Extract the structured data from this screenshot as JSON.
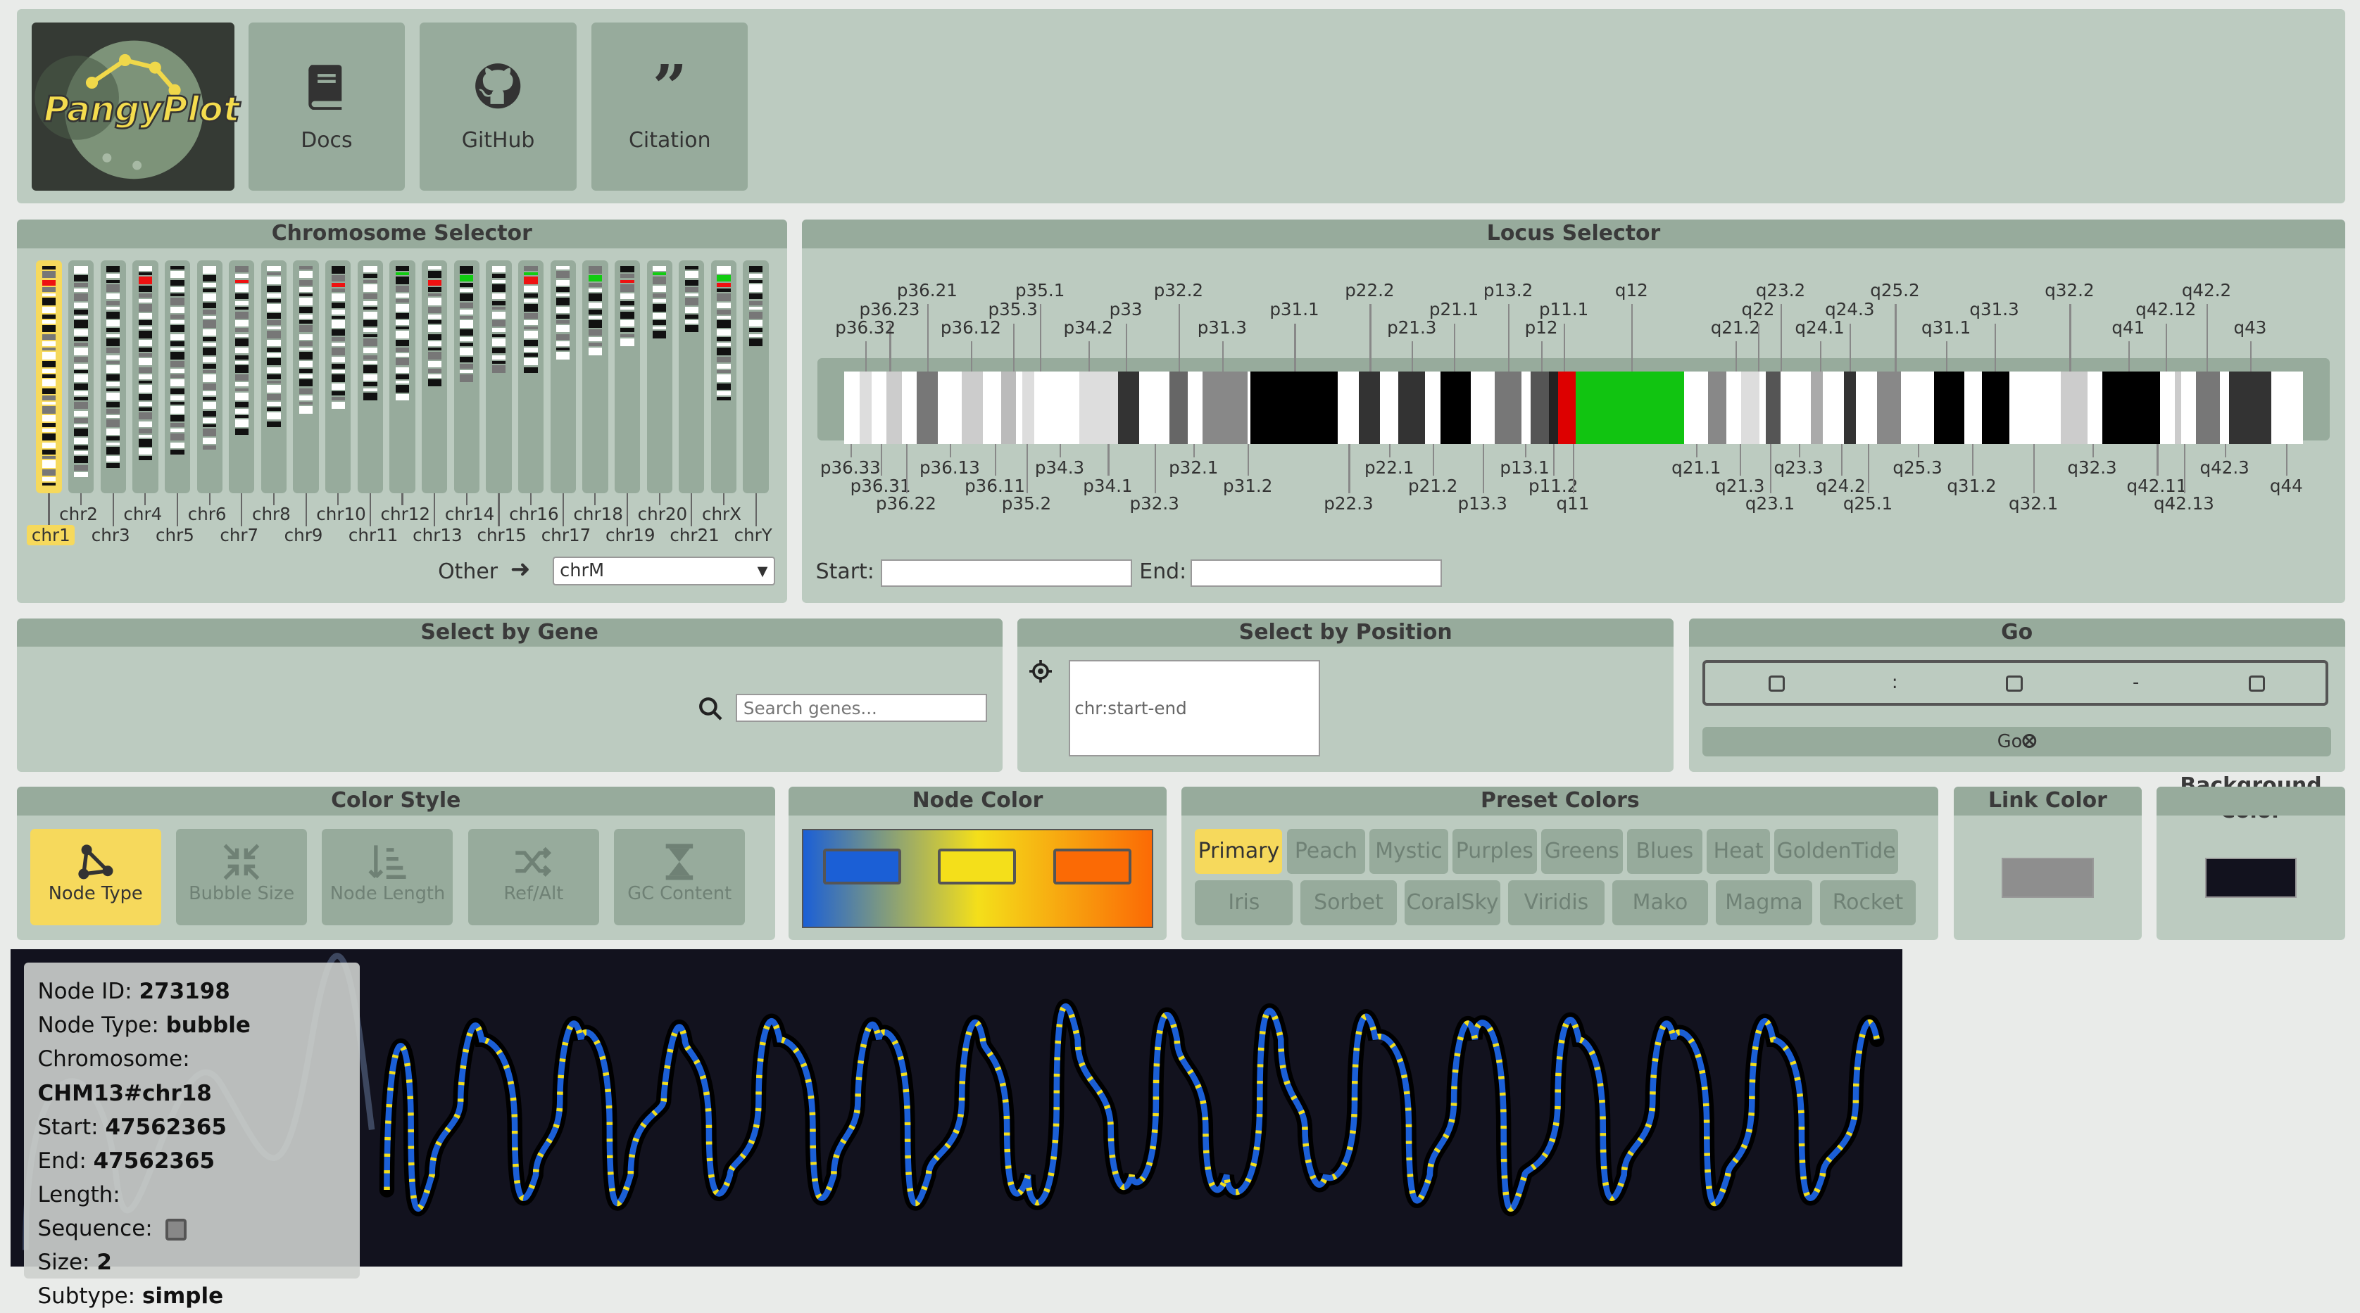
{
  "header": {
    "logo_text": "PangyPlot",
    "nav": [
      {
        "label": "Docs",
        "icon": "book-icon"
      },
      {
        "label": "GitHub",
        "icon": "github-icon"
      },
      {
        "label": "Citation",
        "icon": "quote-icon"
      }
    ]
  },
  "chromosome_selector": {
    "title": "Chromosome Selector",
    "selected": "chr1",
    "top_labels": [
      "chr2",
      "chr4",
      "chr6",
      "chr8",
      "chr10",
      "chr12",
      "chr14",
      "chr16",
      "chr18",
      "chr20",
      "chrX"
    ],
    "bottom_labels": [
      "chr1",
      "chr3",
      "chr5",
      "chr7",
      "chr9",
      "chr11",
      "chr13",
      "chr15",
      "chr17",
      "chr19",
      "chr21",
      "chrY"
    ],
    "other_label": "Other",
    "other_value": "chrM"
  },
  "locus_selector": {
    "title": "Locus Selector",
    "bands_top": [
      "p36.21",
      "p36.23",
      "p36.32",
      "p35.1",
      "p35.3",
      "p36.12",
      "p34.2",
      "p33",
      "p32.2",
      "p31.3",
      "p31.1",
      "p22.2",
      "p21.3",
      "p21.1",
      "p13.2",
      "p12",
      "p11.1",
      "q12",
      "q21.2",
      "q22",
      "q23.2",
      "q24.1",
      "q24.3",
      "q25.2",
      "q31.1",
      "q31.3",
      "q32.2",
      "q41",
      "q42.12",
      "q42.2",
      "q43"
    ],
    "bands_bottom": [
      "p36.33",
      "p36.31",
      "p36.22",
      "p36.13",
      "p36.11",
      "p35.2",
      "p34.3",
      "p34.1",
      "p32.3",
      "p32.1",
      "p31.2",
      "p22.3",
      "p22.1",
      "p21.2",
      "p13.3",
      "p13.1",
      "p11.2",
      "q11",
      "q21.1",
      "q21.3",
      "q23.1",
      "q23.3",
      "q24.2",
      "q25.1",
      "q25.3",
      "q31.2",
      "q32.1",
      "q32.3",
      "q42.11",
      "q42.13",
      "q42.3",
      "q44"
    ],
    "start_label": "Start:",
    "end_label": "End:"
  },
  "gene_selector": {
    "title": "Select by Gene",
    "placeholder": "Search genes..."
  },
  "position_selector": {
    "title": "Select by Position",
    "placeholder": "chr:start-end"
  },
  "go_panel": {
    "title": "Go",
    "sep1": ":",
    "sep2": "-",
    "button": "Go"
  },
  "color_style": {
    "title": "Color Style",
    "options": [
      {
        "label": "Node Type",
        "icon": "node-type-icon",
        "active": true
      },
      {
        "label": "Bubble Size",
        "icon": "bubble-size-icon",
        "active": false
      },
      {
        "label": "Node Length",
        "icon": "node-length-icon",
        "active": false
      },
      {
        "label": "Ref/Alt",
        "icon": "shuffle-icon",
        "active": false
      },
      {
        "label": "GC Content",
        "icon": "hourglass-icon",
        "active": false
      }
    ]
  },
  "node_color": {
    "title": "Node Color",
    "swatches": [
      "#1b5fd6",
      "#f4df1a",
      "#fb6a05"
    ]
  },
  "preset_colors": {
    "title": "Preset Colors",
    "row1": [
      "Primary",
      "Peach",
      "Mystic",
      "Purples",
      "Greens",
      "Blues",
      "Heat",
      "GoldenTide"
    ],
    "row2": [
      "Iris",
      "Sorbet",
      "CoralSky",
      "Viridis",
      "Mako",
      "Magma",
      "Rocket"
    ],
    "active": "Primary"
  },
  "link_color": {
    "title": "Link Color",
    "value": "#8e8e8e"
  },
  "background_color": {
    "title": "Background Color",
    "value": "#12121e"
  },
  "tooltip": {
    "node_id_label": "Node ID:",
    "node_id": "273198",
    "node_type_label": "Node Type:",
    "node_type": "bubble",
    "chromosome_label": "Chromosome:",
    "chromosome": "CHM13#chr18",
    "start_label": "Start:",
    "start": "47562365",
    "end_label": "End:",
    "end": "47562365",
    "length_label": "Length:",
    "sequence_label": "Sequence:",
    "size_label": "Size:",
    "size": "2",
    "subtype_label": "Subtype:",
    "subtype": "simple"
  }
}
